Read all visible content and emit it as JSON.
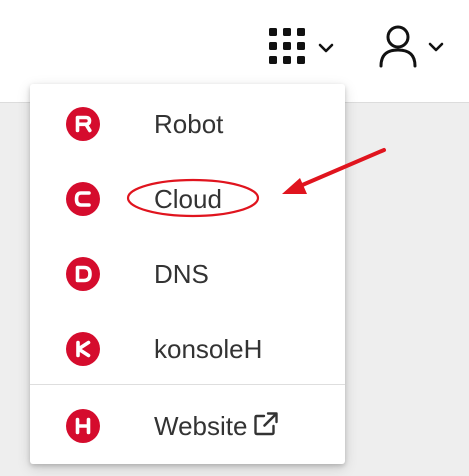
{
  "header": {
    "apps_icon": "grid-icon",
    "user_icon": "user-icon",
    "chevron_icon": "chevron-down-icon"
  },
  "menu": {
    "items": [
      {
        "letter": "R",
        "label": "Robot"
      },
      {
        "letter": "C",
        "label": "Cloud"
      },
      {
        "letter": "D",
        "label": "DNS"
      },
      {
        "letter": "K",
        "label": "konsoleH"
      }
    ],
    "footer_item": {
      "letter": "H",
      "label": "Website",
      "icon": "external-link-icon"
    }
  },
  "annotation": {
    "color": "#e0141e",
    "target": "Cloud"
  },
  "colors": {
    "brand": "#d50c2d",
    "text": "#333333",
    "background": "#eeeeee"
  }
}
